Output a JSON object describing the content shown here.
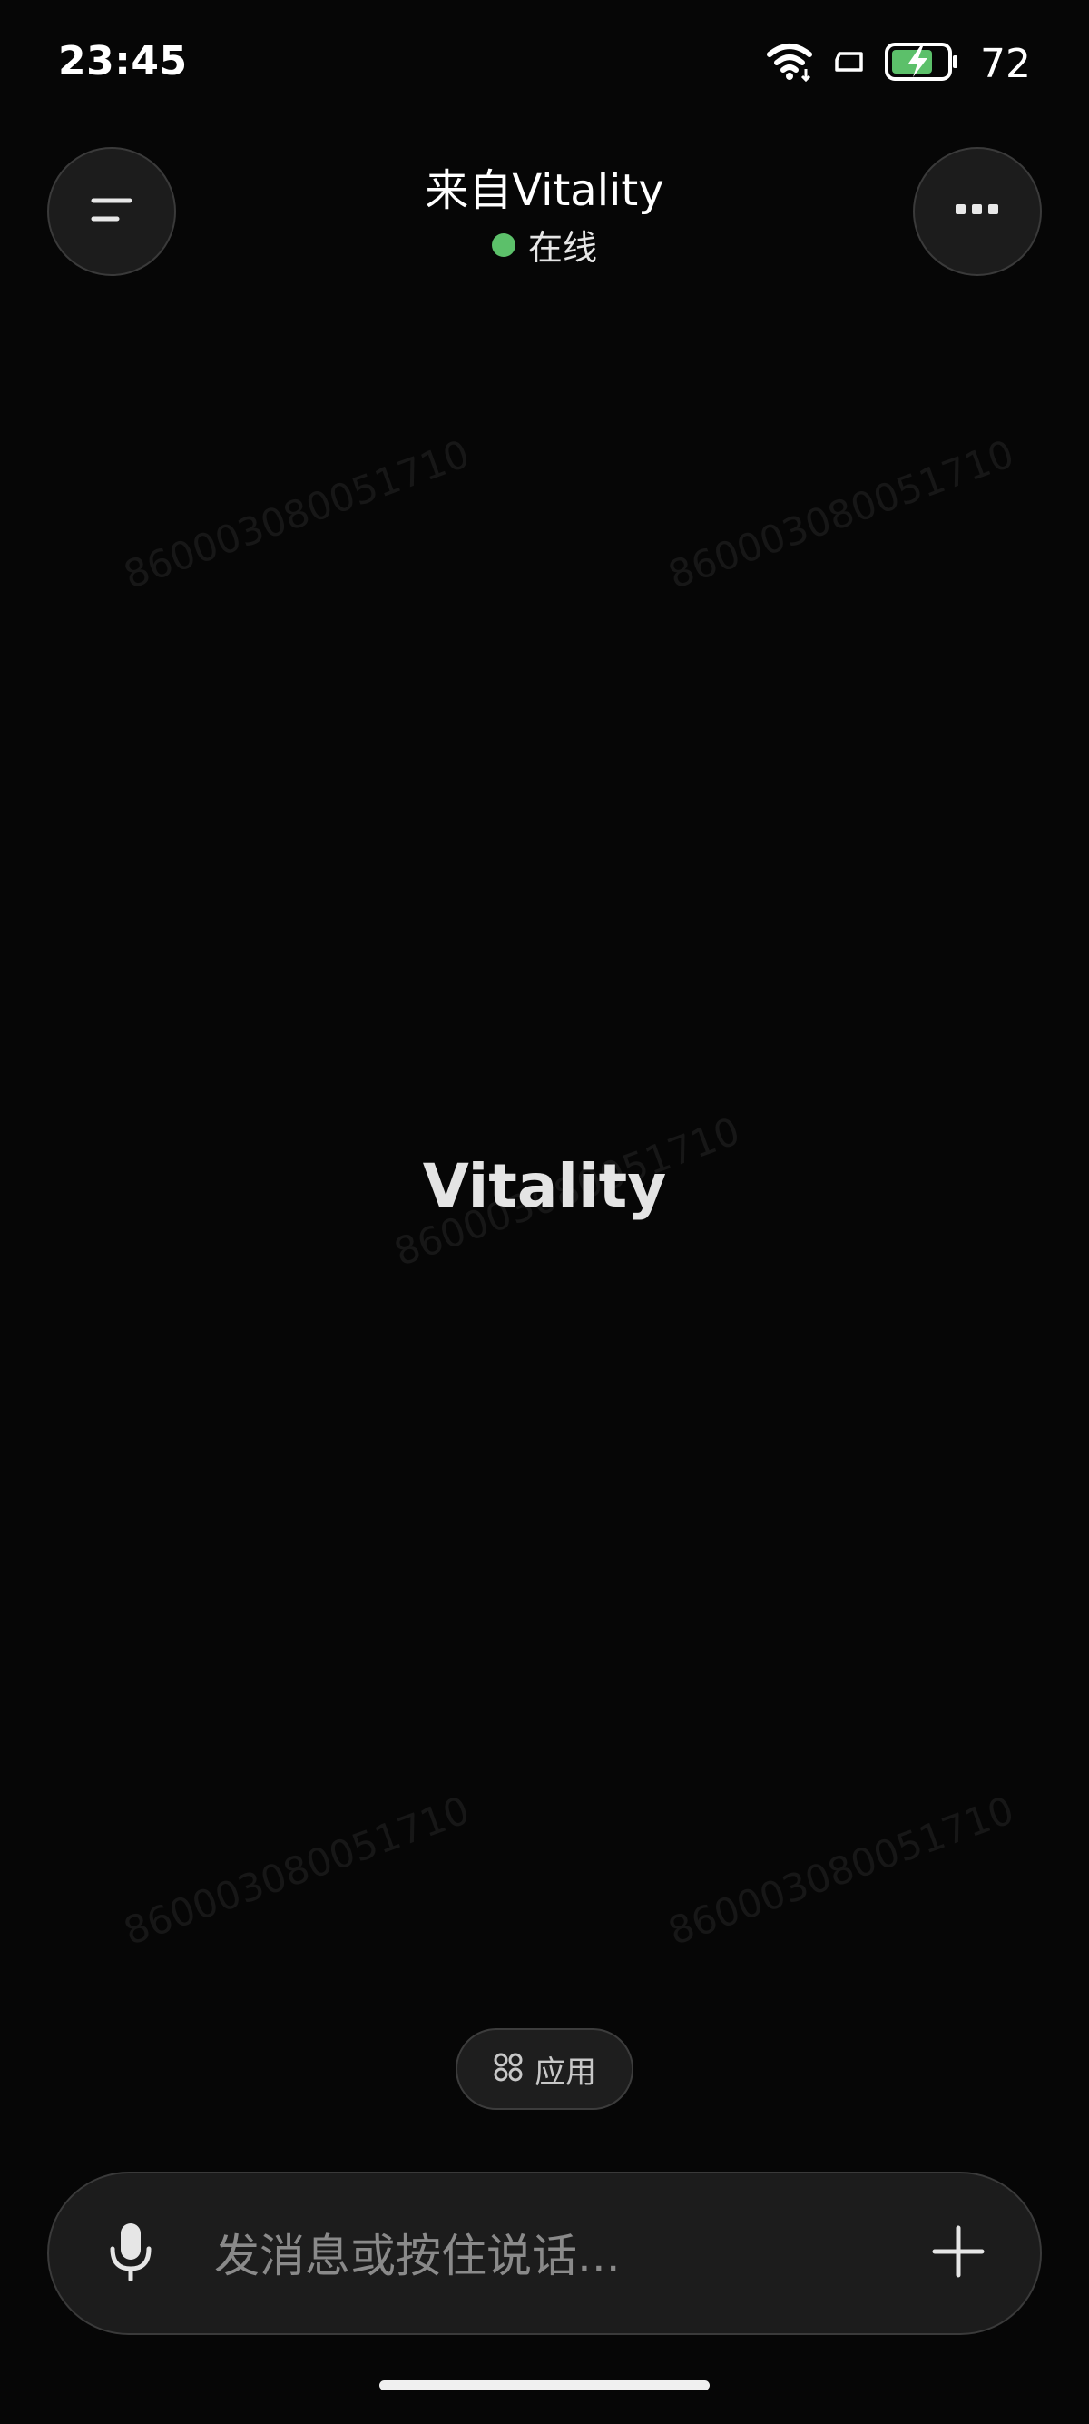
{
  "status_bar": {
    "time": "23:45",
    "battery_level": "72",
    "icons": [
      "wifi-icon",
      "cast-icon",
      "battery-charging-icon"
    ]
  },
  "header": {
    "title": "来自Vitality",
    "status_text": "在线",
    "status_color": "#5cc06a",
    "left_button_icon": "menu-icon",
    "right_button_icon": "more-icon"
  },
  "watermark": {
    "text": "860003080051710"
  },
  "main": {
    "assistant_name": "Vitality"
  },
  "apps_button": {
    "label": "应用",
    "icon": "apps-grid-icon"
  },
  "input_bar": {
    "placeholder": "发消息或按住说话...",
    "mic_icon": "microphone-icon",
    "add_icon": "plus-icon"
  }
}
